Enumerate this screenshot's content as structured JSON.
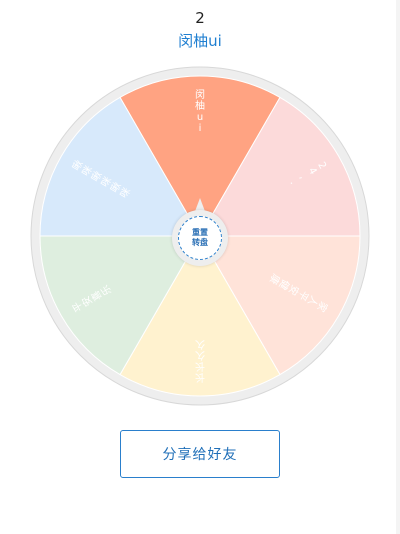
{
  "header": {
    "count": "2",
    "title": "闵柚ui"
  },
  "wheel": {
    "segments": [
      {
        "label": "闵柚ui",
        "color": "#ffa382"
      },
      {
        "label": "24,.",
        "color": "#fcdada"
      },
      {
        "label": "家人平安健康",
        "color": "#ffe3d9"
      },
      {
        "label": "长长久久",
        "color": "#fff2cf"
      },
      {
        "label": "平安喜乐",
        "color": "#deeedf"
      },
      {
        "label": "啾咪啾咪啾咪",
        "color": "#d7e9fb"
      }
    ],
    "rim_color": "#eeeeee",
    "center_line1": "重置",
    "center_line2": "转盘"
  },
  "share": {
    "label": "分享给好友"
  }
}
